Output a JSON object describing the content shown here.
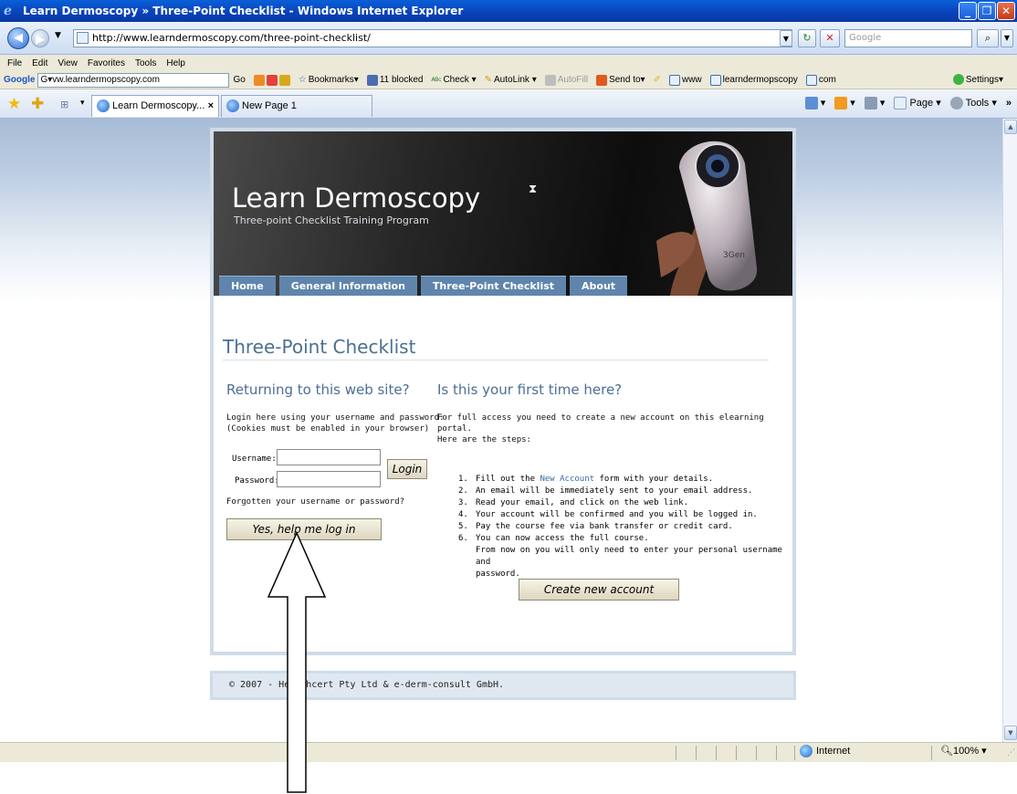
{
  "window": {
    "title": "Learn Dermoscopy » Three-Point Checklist - Windows Internet Explorer",
    "address": "http://www.learndermoscopy.com/three-point-checklist/",
    "search_placeholder": "Google"
  },
  "menu": [
    "File",
    "Edit",
    "View",
    "Favorites",
    "Tools",
    "Help"
  ],
  "google_toolbar": {
    "logo": "Google",
    "box_value": "G▾vw.learndermopscopy.com",
    "go": "Go",
    "items": [
      "Bookmarks▾",
      "11 blocked",
      "Check ▾",
      "AutoLink ▾",
      "AutoFill",
      "Send to▾",
      "www",
      "learndermopscopy",
      "com"
    ],
    "settings": "Settings▾"
  },
  "tabs": [
    {
      "label": "Learn Dermoscopy..."
    },
    {
      "label": "New Page 1"
    }
  ],
  "command_bar": {
    "page": "Page ▾",
    "tools": "Tools ▾",
    "more": "»"
  },
  "site": {
    "title": "Learn Dermoscopy",
    "subtitle": "Three-point Checklist Training Program",
    "device_brand": "3Gen",
    "nav": [
      "Home",
      "General Information",
      "Three-Point Checklist",
      "About"
    ],
    "page_heading": "Three-Point Checklist",
    "returning": {
      "heading": "Returning to this web site?",
      "intro_line1": "Login here using your username and password:",
      "intro_line2": "(Cookies must be enabled in your browser)",
      "username_label": "Username:",
      "password_label": "Password:",
      "login_button": "Login",
      "forgot_text": "Forgotten your username or password?",
      "help_button": "Yes, help me log in"
    },
    "first_time": {
      "heading": "Is this your first time here?",
      "intro": "For full access you need to create a new account on this elearning portal.",
      "steps_intro": "Here are the steps:",
      "steps": [
        {
          "num": "1.",
          "pre": "Fill out the ",
          "link": "New Account",
          "post": " form with your details."
        },
        {
          "num": "2.",
          "text": "An email will be immediately sent to your email address."
        },
        {
          "num": "3.",
          "text": "Read your email, and click on the web link."
        },
        {
          "num": "4.",
          "text": "Your account will be confirmed and you will be logged in."
        },
        {
          "num": "5.",
          "text": "Pay the course fee via bank transfer or credit card."
        },
        {
          "num": "6.",
          "text": "You can now access the full course."
        }
      ],
      "steps_continuation_1": "From now on you will only need to enter your personal username and",
      "steps_continuation_2": "password.",
      "create_button": "Create new account"
    },
    "footer": "© 2007 - Healthcert Pty Ltd & e-derm-consult GmbH."
  },
  "status": {
    "zone": "Internet",
    "zoom": "100%"
  }
}
